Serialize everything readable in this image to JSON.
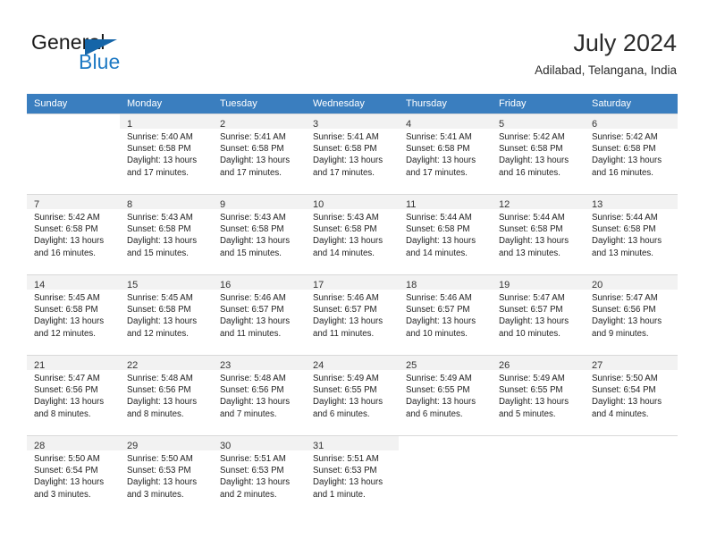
{
  "brand": {
    "word_one": "General",
    "word_two": "Blue",
    "flag_icon": "triangle-flag-icon"
  },
  "header": {
    "title": "July 2024",
    "subtitle": "Adilabad, Telangana, India"
  },
  "colors": {
    "header_row_bg": "#3a7ebf",
    "brand_blue": "#1f7ac4",
    "brand_flag": "#1565a8",
    "daynum_bg": "#f2f2f2",
    "grid_line": "#d9d9d9"
  },
  "calendar": {
    "weekday_headers": [
      "Sunday",
      "Monday",
      "Tuesday",
      "Wednesday",
      "Thursday",
      "Friday",
      "Saturday"
    ],
    "weeks": [
      [
        {
          "day": "",
          "lines": []
        },
        {
          "day": "1",
          "lines": [
            "Sunrise: 5:40 AM",
            "Sunset: 6:58 PM",
            "Daylight: 13 hours",
            "and 17 minutes."
          ]
        },
        {
          "day": "2",
          "lines": [
            "Sunrise: 5:41 AM",
            "Sunset: 6:58 PM",
            "Daylight: 13 hours",
            "and 17 minutes."
          ]
        },
        {
          "day": "3",
          "lines": [
            "Sunrise: 5:41 AM",
            "Sunset: 6:58 PM",
            "Daylight: 13 hours",
            "and 17 minutes."
          ]
        },
        {
          "day": "4",
          "lines": [
            "Sunrise: 5:41 AM",
            "Sunset: 6:58 PM",
            "Daylight: 13 hours",
            "and 17 minutes."
          ]
        },
        {
          "day": "5",
          "lines": [
            "Sunrise: 5:42 AM",
            "Sunset: 6:58 PM",
            "Daylight: 13 hours",
            "and 16 minutes."
          ]
        },
        {
          "day": "6",
          "lines": [
            "Sunrise: 5:42 AM",
            "Sunset: 6:58 PM",
            "Daylight: 13 hours",
            "and 16 minutes."
          ]
        }
      ],
      [
        {
          "day": "7",
          "lines": [
            "Sunrise: 5:42 AM",
            "Sunset: 6:58 PM",
            "Daylight: 13 hours",
            "and 16 minutes."
          ]
        },
        {
          "day": "8",
          "lines": [
            "Sunrise: 5:43 AM",
            "Sunset: 6:58 PM",
            "Daylight: 13 hours",
            "and 15 minutes."
          ]
        },
        {
          "day": "9",
          "lines": [
            "Sunrise: 5:43 AM",
            "Sunset: 6:58 PM",
            "Daylight: 13 hours",
            "and 15 minutes."
          ]
        },
        {
          "day": "10",
          "lines": [
            "Sunrise: 5:43 AM",
            "Sunset: 6:58 PM",
            "Daylight: 13 hours",
            "and 14 minutes."
          ]
        },
        {
          "day": "11",
          "lines": [
            "Sunrise: 5:44 AM",
            "Sunset: 6:58 PM",
            "Daylight: 13 hours",
            "and 14 minutes."
          ]
        },
        {
          "day": "12",
          "lines": [
            "Sunrise: 5:44 AM",
            "Sunset: 6:58 PM",
            "Daylight: 13 hours",
            "and 13 minutes."
          ]
        },
        {
          "day": "13",
          "lines": [
            "Sunrise: 5:44 AM",
            "Sunset: 6:58 PM",
            "Daylight: 13 hours",
            "and 13 minutes."
          ]
        }
      ],
      [
        {
          "day": "14",
          "lines": [
            "Sunrise: 5:45 AM",
            "Sunset: 6:58 PM",
            "Daylight: 13 hours",
            "and 12 minutes."
          ]
        },
        {
          "day": "15",
          "lines": [
            "Sunrise: 5:45 AM",
            "Sunset: 6:58 PM",
            "Daylight: 13 hours",
            "and 12 minutes."
          ]
        },
        {
          "day": "16",
          "lines": [
            "Sunrise: 5:46 AM",
            "Sunset: 6:57 PM",
            "Daylight: 13 hours",
            "and 11 minutes."
          ]
        },
        {
          "day": "17",
          "lines": [
            "Sunrise: 5:46 AM",
            "Sunset: 6:57 PM",
            "Daylight: 13 hours",
            "and 11 minutes."
          ]
        },
        {
          "day": "18",
          "lines": [
            "Sunrise: 5:46 AM",
            "Sunset: 6:57 PM",
            "Daylight: 13 hours",
            "and 10 minutes."
          ]
        },
        {
          "day": "19",
          "lines": [
            "Sunrise: 5:47 AM",
            "Sunset: 6:57 PM",
            "Daylight: 13 hours",
            "and 10 minutes."
          ]
        },
        {
          "day": "20",
          "lines": [
            "Sunrise: 5:47 AM",
            "Sunset: 6:56 PM",
            "Daylight: 13 hours",
            "and 9 minutes."
          ]
        }
      ],
      [
        {
          "day": "21",
          "lines": [
            "Sunrise: 5:47 AM",
            "Sunset: 6:56 PM",
            "Daylight: 13 hours",
            "and 8 minutes."
          ]
        },
        {
          "day": "22",
          "lines": [
            "Sunrise: 5:48 AM",
            "Sunset: 6:56 PM",
            "Daylight: 13 hours",
            "and 8 minutes."
          ]
        },
        {
          "day": "23",
          "lines": [
            "Sunrise: 5:48 AM",
            "Sunset: 6:56 PM",
            "Daylight: 13 hours",
            "and 7 minutes."
          ]
        },
        {
          "day": "24",
          "lines": [
            "Sunrise: 5:49 AM",
            "Sunset: 6:55 PM",
            "Daylight: 13 hours",
            "and 6 minutes."
          ]
        },
        {
          "day": "25",
          "lines": [
            "Sunrise: 5:49 AM",
            "Sunset: 6:55 PM",
            "Daylight: 13 hours",
            "and 6 minutes."
          ]
        },
        {
          "day": "26",
          "lines": [
            "Sunrise: 5:49 AM",
            "Sunset: 6:55 PM",
            "Daylight: 13 hours",
            "and 5 minutes."
          ]
        },
        {
          "day": "27",
          "lines": [
            "Sunrise: 5:50 AM",
            "Sunset: 6:54 PM",
            "Daylight: 13 hours",
            "and 4 minutes."
          ]
        }
      ],
      [
        {
          "day": "28",
          "lines": [
            "Sunrise: 5:50 AM",
            "Sunset: 6:54 PM",
            "Daylight: 13 hours",
            "and 3 minutes."
          ]
        },
        {
          "day": "29",
          "lines": [
            "Sunrise: 5:50 AM",
            "Sunset: 6:53 PM",
            "Daylight: 13 hours",
            "and 3 minutes."
          ]
        },
        {
          "day": "30",
          "lines": [
            "Sunrise: 5:51 AM",
            "Sunset: 6:53 PM",
            "Daylight: 13 hours",
            "and 2 minutes."
          ]
        },
        {
          "day": "31",
          "lines": [
            "Sunrise: 5:51 AM",
            "Sunset: 6:53 PM",
            "Daylight: 13 hours",
            "and 1 minute."
          ]
        },
        {
          "day": "",
          "lines": []
        },
        {
          "day": "",
          "lines": []
        },
        {
          "day": "",
          "lines": []
        }
      ]
    ]
  }
}
